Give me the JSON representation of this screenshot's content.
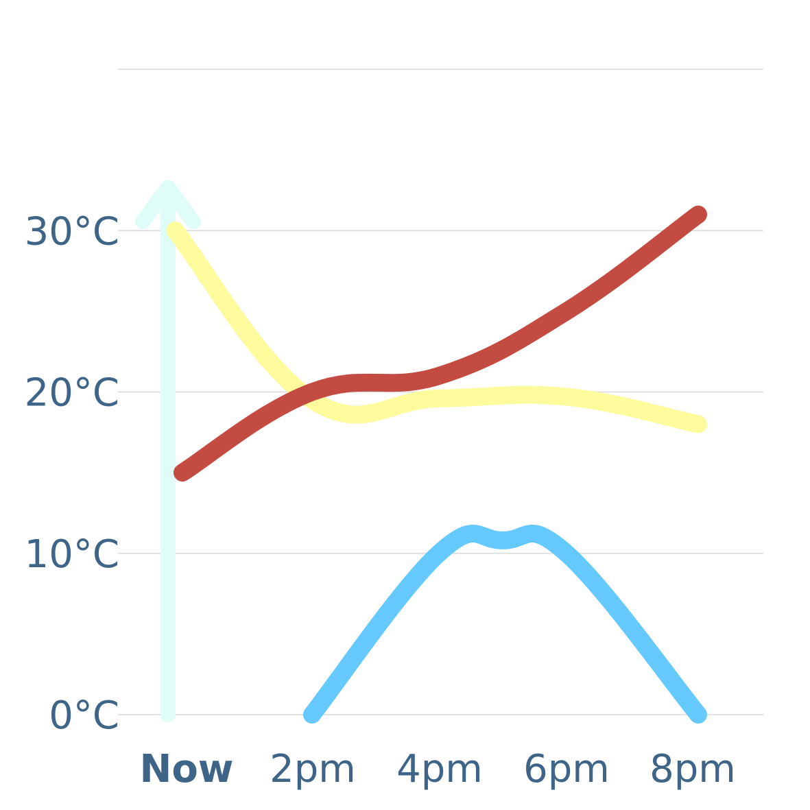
{
  "chart_data": {
    "type": "line",
    "title": "",
    "xlabel": "",
    "ylabel": "",
    "categories": [
      "Now",
      "2pm",
      "4pm",
      "6pm",
      "8pm"
    ],
    "x_highlight": "Now",
    "y_ticks": [
      {
        "value": 0,
        "label": "0°C"
      },
      {
        "value": 10,
        "label": "10°C"
      },
      {
        "value": 20,
        "label": "20°C"
      },
      {
        "value": 30,
        "label": "30°C"
      }
    ],
    "ylim": [
      0,
      40
    ],
    "grid": true,
    "now_marker": {
      "color": "#dffcf8",
      "from": 0,
      "to": 32
    },
    "series": [
      {
        "color": "#fdfb9c",
        "points": [
          [
            0.05,
            30
          ],
          [
            1.0,
            19.5
          ],
          [
            2.0,
            19.6
          ],
          [
            3.0,
            19.7
          ],
          [
            4.0,
            18
          ]
        ]
      },
      {
        "color": "#c34b41",
        "points": [
          [
            0.1,
            15
          ],
          [
            1.0,
            20
          ],
          [
            2.0,
            21
          ],
          [
            3.0,
            25
          ],
          [
            4.0,
            31
          ]
        ]
      },
      {
        "color": "#66c9fe",
        "points": [
          [
            1.0,
            0
          ],
          [
            2.0,
            10
          ],
          [
            2.5,
            10.8
          ],
          [
            3.0,
            10
          ],
          [
            4.0,
            0
          ]
        ]
      }
    ]
  }
}
